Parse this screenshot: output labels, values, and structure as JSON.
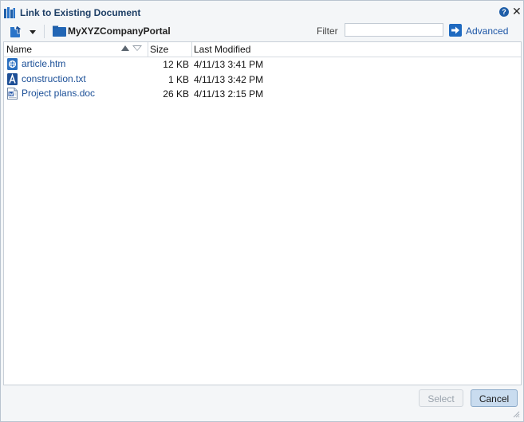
{
  "dialog": {
    "title": "Link to Existing Document",
    "help_glyph": "?",
    "close_glyph": "✕"
  },
  "toolbar": {
    "current_folder": "MyXYZCompanyPortal",
    "filter_label": "Filter",
    "filter_value": "",
    "filter_placeholder": "",
    "advanced_label": "Advanced"
  },
  "table": {
    "columns": [
      "Name",
      "Size",
      "Last Modified"
    ],
    "sort": {
      "column": "Name",
      "direction": "ascending"
    },
    "rows": [
      {
        "icon": "web-page-icon",
        "name": "article.htm",
        "size": "12 KB",
        "modified": "4/11/13 3:41 PM"
      },
      {
        "icon": "text-file-icon",
        "name": "construction.txt",
        "size": "1 KB",
        "modified": "4/11/13 3:42 PM"
      },
      {
        "icon": "word-document-icon",
        "name": "Project plans.doc",
        "size": "26 KB",
        "modified": "4/11/13 2:15 PM"
      }
    ]
  },
  "footer": {
    "select_label": "Select",
    "select_enabled": false,
    "cancel_label": "Cancel"
  },
  "colors": {
    "title_text": "#1e3f66",
    "link_blue": "#1b4f97",
    "accent": "#1f6ac0",
    "cancel_bg": "#c9dcef"
  }
}
